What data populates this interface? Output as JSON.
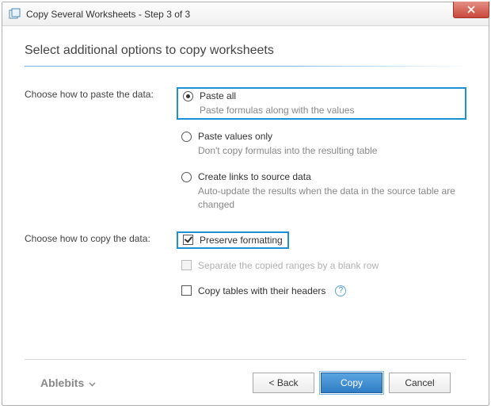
{
  "window": {
    "title": "Copy Several Worksheets - Step 3 of 3"
  },
  "page": {
    "title": "Select additional options to copy worksheets"
  },
  "paste": {
    "prompt": "Choose how to paste the data:",
    "options": [
      {
        "label": "Paste all",
        "desc": "Paste formulas along with the values"
      },
      {
        "label": "Paste values only",
        "desc": "Don't copy formulas into the resulting table"
      },
      {
        "label": "Create links to source data",
        "desc": "Auto-update the results when the data in the source table are changed"
      }
    ]
  },
  "copy": {
    "prompt": "Choose how to copy the data:",
    "options": [
      {
        "label": "Preserve formatting"
      },
      {
        "label": "Separate the copied ranges by a blank row"
      },
      {
        "label": "Copy tables with their headers"
      }
    ]
  },
  "footer": {
    "brand": "Ablebits",
    "back": "<  Back",
    "primary": "Copy",
    "cancel": "Cancel"
  }
}
